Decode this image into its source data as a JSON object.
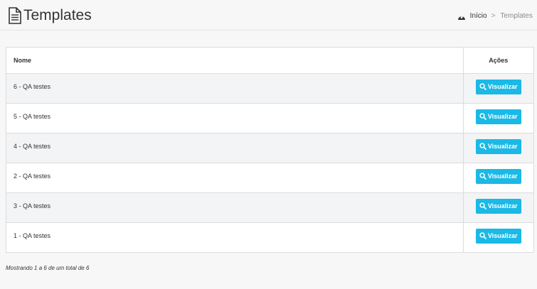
{
  "header": {
    "title": "Templates",
    "title_icon": "document-icon",
    "breadcrumb": {
      "home_icon": "dashboard-icon",
      "home_label": "Início",
      "separator": ">",
      "current": "Templates"
    }
  },
  "table": {
    "columns": {
      "name": "Nome",
      "actions": "Ações"
    },
    "action_label": "Visualizar",
    "action_icon": "search-icon",
    "rows": [
      {
        "name": "6 - QA testes"
      },
      {
        "name": "5 - QA testes"
      },
      {
        "name": "4 - QA testes"
      },
      {
        "name": "2 - QA testes"
      },
      {
        "name": "3 - QA testes"
      },
      {
        "name": "1 - QA testes"
      }
    ]
  },
  "footer": {
    "summary": "Mostrando 1 a 6 de um total de 6"
  },
  "colors": {
    "accent": "#1ab9e6",
    "row_alt": "#f3f4f5",
    "background": "#f7f7f7"
  }
}
